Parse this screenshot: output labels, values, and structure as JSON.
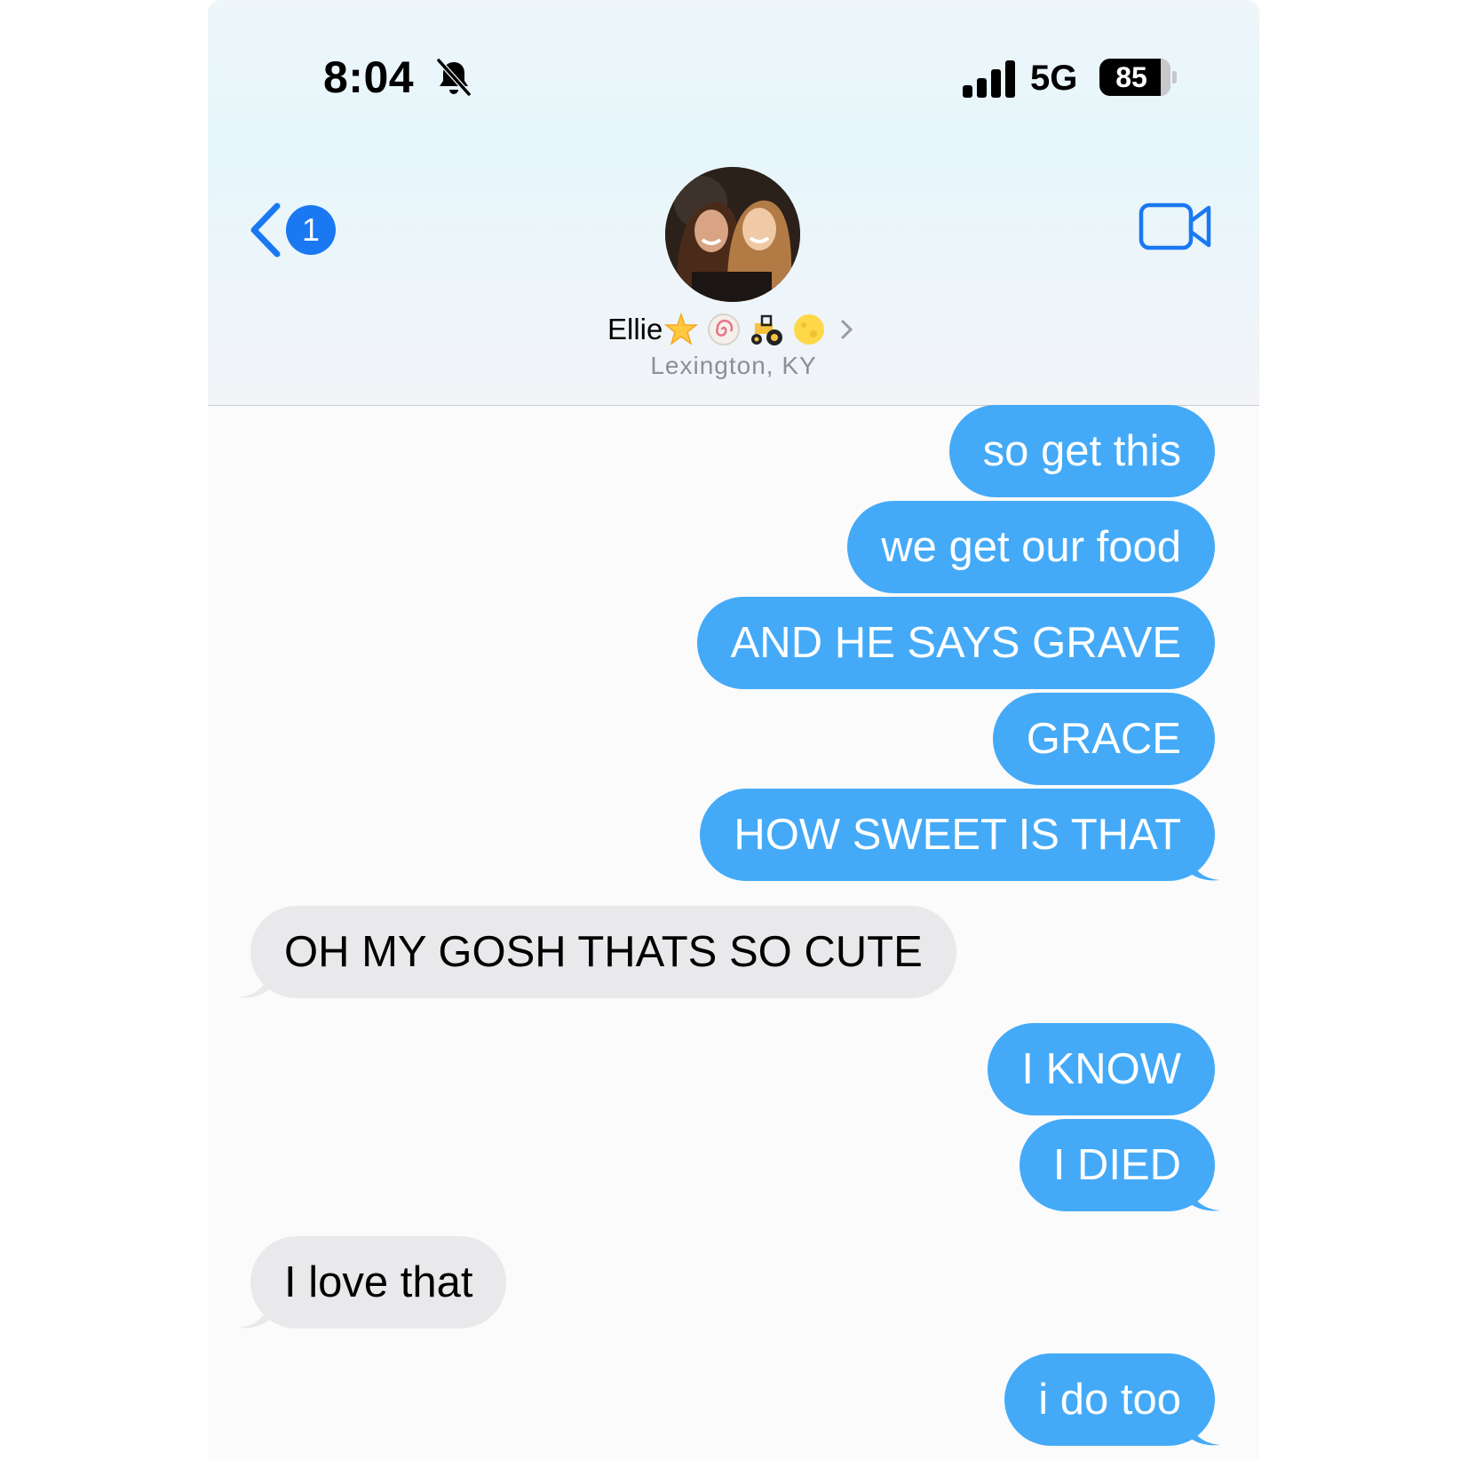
{
  "status_bar": {
    "time": "8:04",
    "network": "5G",
    "battery": "85",
    "silent_icon": "bell-slash-icon",
    "signal_icon": "cellular-signal-icon"
  },
  "nav": {
    "back_badge": "1",
    "back_icon": "chevron-left-icon",
    "video_icon": "video-camera-icon"
  },
  "contact": {
    "name": "Ellie",
    "name_emojis": [
      "star-emoji",
      "fishcake-emoji",
      "tractor-emoji",
      "moon-emoji"
    ],
    "subtitle": "Lexington, KY"
  },
  "colors": {
    "outgoing_bubble": "#44aaf7",
    "incoming_bubble": "#e9e9eb",
    "accent": "#1a78f2"
  },
  "messages": [
    {
      "from": "me",
      "text": "so get this"
    },
    {
      "from": "me",
      "text": "we get our food"
    },
    {
      "from": "me",
      "text": "AND HE SAYS GRAVE"
    },
    {
      "from": "me",
      "text": "GRACE"
    },
    {
      "from": "me",
      "text": "HOW SWEET IS THAT"
    },
    {
      "from": "them",
      "text": "OH MY GOSH THATS SO CUTE"
    },
    {
      "from": "me",
      "text": "I KNOW"
    },
    {
      "from": "me",
      "text": "I DIED"
    },
    {
      "from": "them",
      "text": "I love that"
    },
    {
      "from": "me",
      "text": "i do too"
    }
  ]
}
